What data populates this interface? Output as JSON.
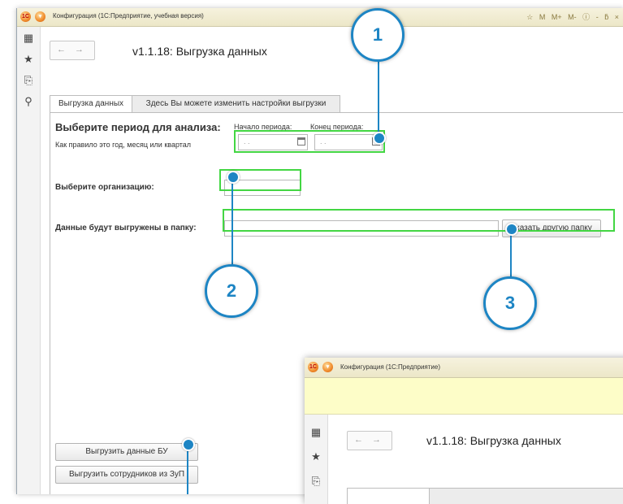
{
  "main_window": {
    "title": "Конфигурация  (1С:Предприятие, учебная версия)",
    "logo": "1С",
    "toolbar_icons": [
      "star-icon",
      "m",
      "m+",
      "m-",
      "info-icon",
      "minimize",
      "maximize",
      "close"
    ],
    "toolbar_text": [
      "M",
      "M+",
      "M-",
      "ⓘ",
      "-",
      "ƃ",
      "×"
    ],
    "sidebar_icons": [
      "apps-icon",
      "favorites-icon",
      "history-icon",
      "search-icon"
    ],
    "nav": {
      "back": "←",
      "forward": "→"
    },
    "page_title": "v1.1.18: Выгрузка данных",
    "tabs": [
      {
        "label": "Выгрузка данных",
        "active": true
      },
      {
        "label": "Здесь Вы можете изменить настройки выгрузки",
        "active": false
      }
    ],
    "period": {
      "heading": "Выберите период для анализа:",
      "hint": "Как правило это год, месяц или квартал",
      "start_label": "Начало периода:",
      "end_label": "Конец периода:",
      "start_value": " .  .",
      "end_value": " .  ."
    },
    "organization": {
      "label": "Выберите организацию:",
      "value": ""
    },
    "folder": {
      "label": "Данные будут выгружены в папку:",
      "value": "",
      "button": "Указать другую папку"
    },
    "buttons": {
      "export_bu": "Выгрузить данные БУ",
      "export_employees": "Выгрузить сотрудников из ЗуП"
    }
  },
  "callouts": [
    "1",
    "2",
    "3"
  ],
  "highlight_color": "#43d643",
  "callout_color": "#1d85c4",
  "second_window": {
    "title": "Конфигурация  (1С:Предприятие)",
    "logo": "1С",
    "page_title": "v1.1.18: Выгрузка данных",
    "nav": {
      "back": "←",
      "forward": "→"
    }
  }
}
